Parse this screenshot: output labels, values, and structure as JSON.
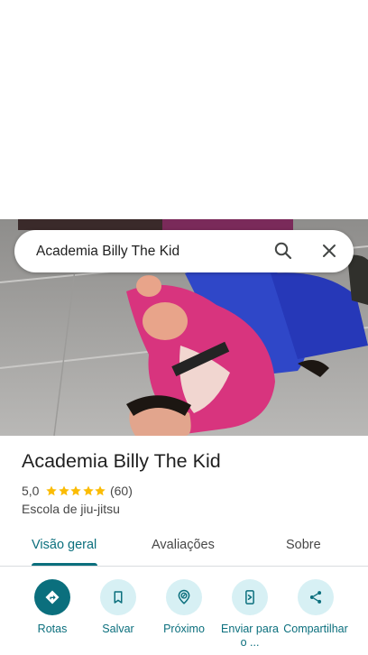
{
  "search": {
    "query": "Academia Billy The Kid",
    "search_icon": "search-icon",
    "close_icon": "close-icon"
  },
  "place": {
    "name": "Academia Billy The Kid",
    "rating": "5,0",
    "stars": 5,
    "review_count": "(60)",
    "category": "Escola de jiu-jitsu"
  },
  "tabs": [
    {
      "label": "Visão geral",
      "active": true
    },
    {
      "label": "Avaliações",
      "active": false
    },
    {
      "label": "Sobre",
      "active": false
    }
  ],
  "actions": [
    {
      "label": "Rotas",
      "icon": "directions-icon"
    },
    {
      "label": "Salvar",
      "icon": "bookmark-icon"
    },
    {
      "label": "Próximo",
      "icon": "nearby-icon"
    },
    {
      "label": "Enviar para o ...",
      "icon": "send-to-phone-icon"
    },
    {
      "label": "Compartilhar",
      "icon": "share-icon"
    }
  ],
  "colors": {
    "accent": "#0b6f7d",
    "accent_light": "#d7f0f4",
    "star": "#fbbc04"
  }
}
